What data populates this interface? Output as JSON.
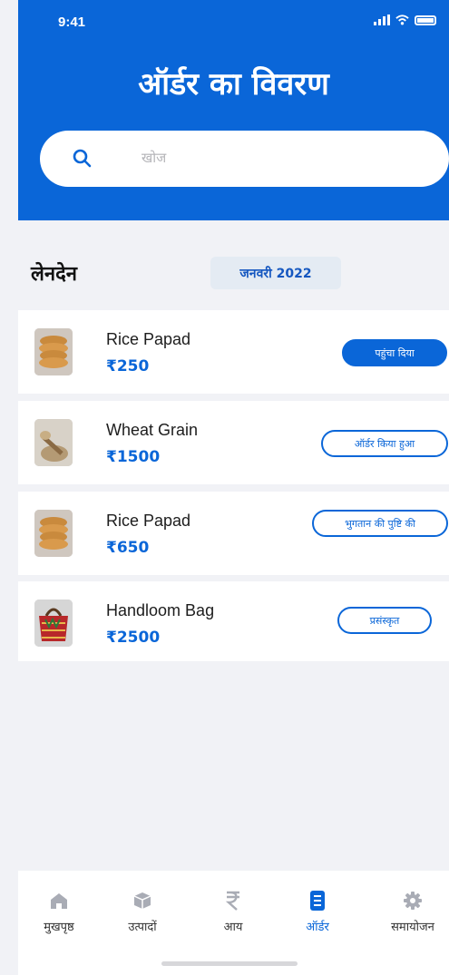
{
  "status": {
    "time": "9:41"
  },
  "header": {
    "title": "ऑर्डर का विवरण"
  },
  "search": {
    "placeholder": "खोज"
  },
  "section": {
    "label": "लेनदेन",
    "month": "जनवरी 2022"
  },
  "orders": [
    {
      "name": "Rice Papad",
      "price": "₹250",
      "status": "पहुंचा दिया",
      "thumb": "papad"
    },
    {
      "name": "Wheat Grain",
      "price": "₹1500",
      "status": "ऑर्डर किया हुआ",
      "thumb": "wheat"
    },
    {
      "name": "Rice Papad",
      "price": "₹650",
      "status": "भुगतान की पुष्टि की",
      "thumb": "papad"
    },
    {
      "name": "Handloom Bag",
      "price": "₹2500",
      "status": "प्रसंस्कृत",
      "thumb": "bag"
    }
  ],
  "tabs": [
    {
      "label": "मुखपृष्ठ",
      "icon": "home-icon"
    },
    {
      "label": "उत्पादों",
      "icon": "box-icon"
    },
    {
      "label": "आय",
      "icon": "rupee-icon"
    },
    {
      "label": "ऑर्डर",
      "icon": "document-icon"
    },
    {
      "label": "समायोजन",
      "icon": "gear-icon"
    }
  ],
  "colors": {
    "accent": "#0a66d8",
    "background": "#f1f2f6"
  }
}
